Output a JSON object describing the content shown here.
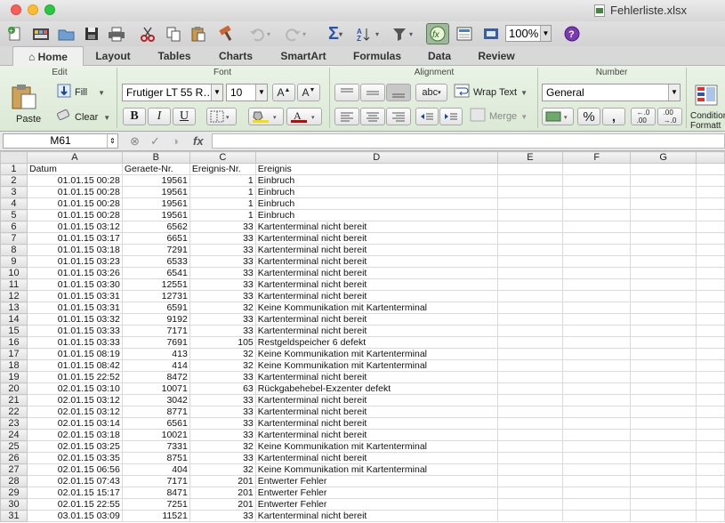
{
  "window": {
    "title": "Fehlerliste.xlsx"
  },
  "toolbar": {
    "zoom": "100%"
  },
  "tabs": [
    "Home",
    "Layout",
    "Tables",
    "Charts",
    "SmartArt",
    "Formulas",
    "Data",
    "Review"
  ],
  "ribbon": {
    "groups": {
      "edit": "Edit",
      "font": "Font",
      "alignment": "Alignment",
      "number": "Number"
    },
    "paste": "Paste",
    "fill": "Fill",
    "clear": "Clear",
    "font_name": "Frutiger LT 55 R…",
    "font_size": "10",
    "bold": "B",
    "italic": "I",
    "underline": "U",
    "wrap_text": "Wrap Text",
    "merge": "Merge",
    "number_format": "General",
    "percent": "%",
    "comma": ",",
    "abc": "abc",
    "conditional": [
      "Condition",
      "Formatt"
    ]
  },
  "formula_bar": {
    "name_box": "M61",
    "fx": "fx",
    "value": ""
  },
  "columns": [
    "A",
    "B",
    "C",
    "D",
    "E",
    "F",
    "G"
  ],
  "rows": [
    [
      "Datum",
      "Geraete-Nr.",
      "Ereignis-Nr.",
      "Ereignis"
    ],
    [
      "01.01.15 00:28",
      "19561",
      "1",
      "Einbruch"
    ],
    [
      "01.01.15 00:28",
      "19561",
      "1",
      "Einbruch"
    ],
    [
      "01.01.15 00:28",
      "19561",
      "1",
      "Einbruch"
    ],
    [
      "01.01.15 00:28",
      "19561",
      "1",
      "Einbruch"
    ],
    [
      "01.01.15 03:12",
      "6562",
      "33",
      "Kartenterminal nicht bereit"
    ],
    [
      "01.01.15 03:17",
      "6651",
      "33",
      "Kartenterminal nicht bereit"
    ],
    [
      "01.01.15 03:18",
      "7291",
      "33",
      "Kartenterminal nicht bereit"
    ],
    [
      "01.01.15 03:23",
      "6533",
      "33",
      "Kartenterminal nicht bereit"
    ],
    [
      "01.01.15 03:26",
      "6541",
      "33",
      "Kartenterminal nicht bereit"
    ],
    [
      "01.01.15 03:30",
      "12551",
      "33",
      "Kartenterminal nicht bereit"
    ],
    [
      "01.01.15 03:31",
      "12731",
      "33",
      "Kartenterminal nicht bereit"
    ],
    [
      "01.01.15 03:31",
      "6591",
      "32",
      "Keine Kommunikation mit Kartenterminal"
    ],
    [
      "01.01.15 03:32",
      "9192",
      "33",
      "Kartenterminal nicht bereit"
    ],
    [
      "01.01.15 03:33",
      "7171",
      "33",
      "Kartenterminal nicht bereit"
    ],
    [
      "01.01.15 03:33",
      "7691",
      "105",
      "Restgeldspeicher 6 defekt"
    ],
    [
      "01.01.15 08:19",
      "413",
      "32",
      "Keine Kommunikation mit Kartenterminal"
    ],
    [
      "01.01.15 08:42",
      "414",
      "32",
      "Keine Kommunikation mit Kartenterminal"
    ],
    [
      "01.01.15 22:52",
      "8472",
      "33",
      "Kartenterminal nicht bereit"
    ],
    [
      "02.01.15 03:10",
      "10071",
      "63",
      "Rückgabehebel-Exzenter defekt"
    ],
    [
      "02.01.15 03:12",
      "3042",
      "33",
      "Kartenterminal nicht bereit"
    ],
    [
      "02.01.15 03:12",
      "8771",
      "33",
      "Kartenterminal nicht bereit"
    ],
    [
      "02.01.15 03:14",
      "6561",
      "33",
      "Kartenterminal nicht bereit"
    ],
    [
      "02.01.15 03:18",
      "10021",
      "33",
      "Kartenterminal nicht bereit"
    ],
    [
      "02.01.15 03:25",
      "7331",
      "32",
      "Keine Kommunikation mit Kartenterminal"
    ],
    [
      "02.01.15 03:35",
      "8751",
      "33",
      "Kartenterminal nicht bereit"
    ],
    [
      "02.01.15 06:56",
      "404",
      "32",
      "Keine Kommunikation mit Kartenterminal"
    ],
    [
      "02.01.15 07:43",
      "7171",
      "201",
      "Entwerter Fehler"
    ],
    [
      "02.01.15 15:17",
      "8471",
      "201",
      "Entwerter Fehler"
    ],
    [
      "02.01.15 22:55",
      "7251",
      "201",
      "Entwerter Fehler"
    ],
    [
      "03.01.15 03:09",
      "11521",
      "33",
      "Kartenterminal nicht bereit"
    ]
  ]
}
